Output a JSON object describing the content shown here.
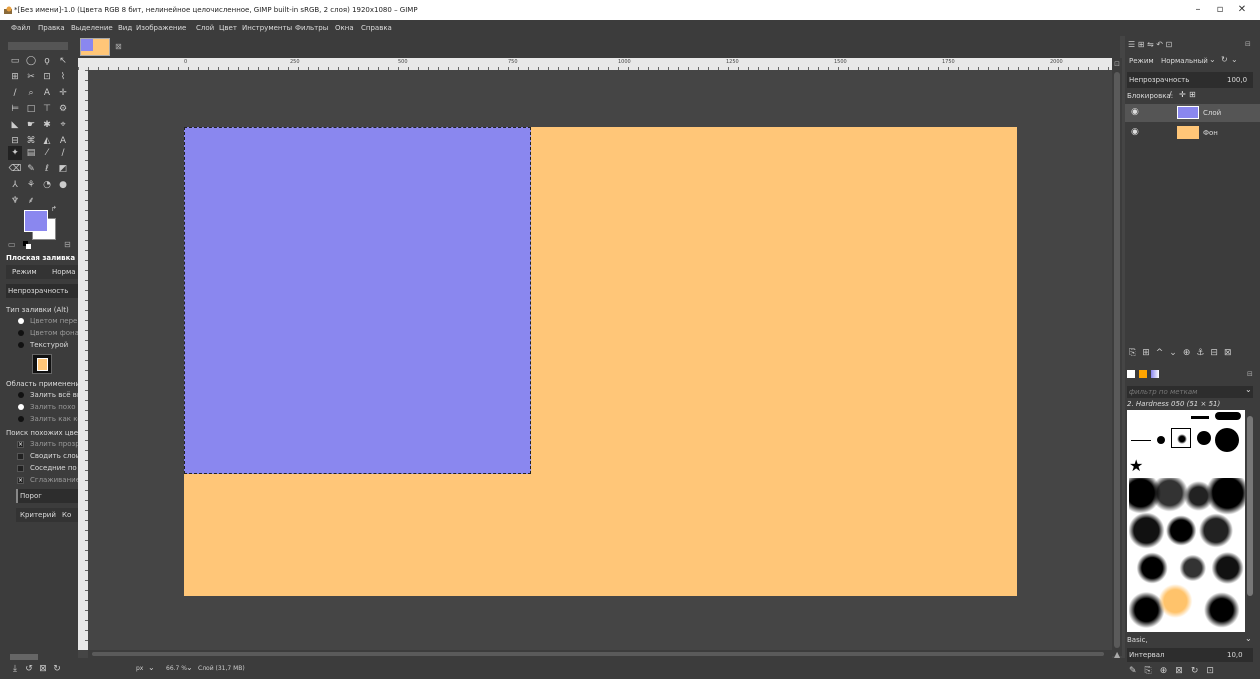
{
  "window": {
    "title": "*[Без имени]-1.0 (Цвета RGB 8 бит, нелинейное целочисленное, GIMP built-in sRGB, 2 слоя) 1920x1080 – GIMP",
    "minimize": "–",
    "maximize": "▫",
    "close": "✕"
  },
  "menu": [
    "Файл",
    "Правка",
    "Выделение",
    "Вид",
    "Изображение",
    "Слой",
    "Цвет",
    "Инструменты",
    "Фильтры",
    "Окна",
    "Справка"
  ],
  "tool_options": {
    "title": "Плоская заливка",
    "mode_label": "Режим",
    "mode_value": "Норма",
    "opacity_label": "Непрозрачность",
    "fill_type_label": "Тип заливки (Alt)",
    "fill_fg": "Цветом пере",
    "fill_bg": "Цветом фона",
    "fill_pattern": "Текстурой",
    "area_label": "Область применени",
    "area_whole": "Залить всё вы",
    "area_similar": "Залить похо",
    "area_line": "Залить как ко",
    "similar_label": "Поиск похожих цве",
    "fill_transparent": "Залить прозр",
    "sample_merged": "Сводить слои",
    "diagonal": "Соседние по",
    "antialias": "Сглаживание",
    "threshold": "Порог",
    "criterion": "Критерий",
    "criterion_value": "Ко"
  },
  "ruler_labels": [
    "0",
    "250",
    "500",
    "750",
    "1000",
    "1250",
    "1500",
    "1750",
    "2000"
  ],
  "colors": {
    "fg": "#8a87ef",
    "bg_layer": "#ffc678",
    "fg_layer": "#8a87ef",
    "canvas": "#454545"
  },
  "status": {
    "unit": "px",
    "zoom": "66.7 %",
    "info": "Слой (31,7 MB)"
  },
  "layers_panel": {
    "mode_label": "Режим",
    "mode_value": "Нормальный",
    "opacity_label": "Непрозрачность",
    "opacity_value": "100,0",
    "lock_label": "Блокировка:",
    "layers": [
      {
        "name": "Слой"
      },
      {
        "name": "Фон"
      }
    ]
  },
  "brushes_panel": {
    "filter_placeholder": "фильтр по меткам",
    "selected_brush": "2. Hardness 050 (51 × 51)",
    "preset": "Basic,",
    "spacing_label": "Интервал",
    "spacing_value": "10,0"
  }
}
